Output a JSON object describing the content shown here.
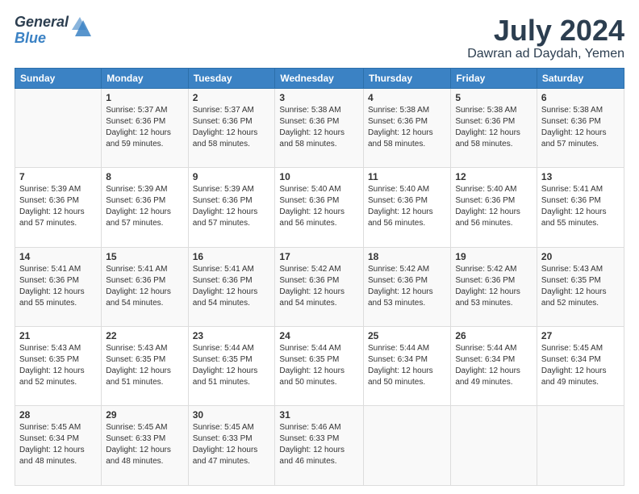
{
  "header": {
    "logo_general": "General",
    "logo_blue": "Blue",
    "month_title": "July 2024",
    "location": "Dawran ad Daydah, Yemen"
  },
  "days_of_week": [
    "Sunday",
    "Monday",
    "Tuesday",
    "Wednesday",
    "Thursday",
    "Friday",
    "Saturday"
  ],
  "weeks": [
    [
      {
        "day": "",
        "sunrise": "",
        "sunset": "",
        "daylight": ""
      },
      {
        "day": "1",
        "sunrise": "Sunrise: 5:37 AM",
        "sunset": "Sunset: 6:36 PM",
        "daylight": "Daylight: 12 hours and 59 minutes."
      },
      {
        "day": "2",
        "sunrise": "Sunrise: 5:37 AM",
        "sunset": "Sunset: 6:36 PM",
        "daylight": "Daylight: 12 hours and 58 minutes."
      },
      {
        "day": "3",
        "sunrise": "Sunrise: 5:38 AM",
        "sunset": "Sunset: 6:36 PM",
        "daylight": "Daylight: 12 hours and 58 minutes."
      },
      {
        "day": "4",
        "sunrise": "Sunrise: 5:38 AM",
        "sunset": "Sunset: 6:36 PM",
        "daylight": "Daylight: 12 hours and 58 minutes."
      },
      {
        "day": "5",
        "sunrise": "Sunrise: 5:38 AM",
        "sunset": "Sunset: 6:36 PM",
        "daylight": "Daylight: 12 hours and 58 minutes."
      },
      {
        "day": "6",
        "sunrise": "Sunrise: 5:38 AM",
        "sunset": "Sunset: 6:36 PM",
        "daylight": "Daylight: 12 hours and 57 minutes."
      }
    ],
    [
      {
        "day": "7",
        "sunrise": "Sunrise: 5:39 AM",
        "sunset": "Sunset: 6:36 PM",
        "daylight": "Daylight: 12 hours and 57 minutes."
      },
      {
        "day": "8",
        "sunrise": "Sunrise: 5:39 AM",
        "sunset": "Sunset: 6:36 PM",
        "daylight": "Daylight: 12 hours and 57 minutes."
      },
      {
        "day": "9",
        "sunrise": "Sunrise: 5:39 AM",
        "sunset": "Sunset: 6:36 PM",
        "daylight": "Daylight: 12 hours and 57 minutes."
      },
      {
        "day": "10",
        "sunrise": "Sunrise: 5:40 AM",
        "sunset": "Sunset: 6:36 PM",
        "daylight": "Daylight: 12 hours and 56 minutes."
      },
      {
        "day": "11",
        "sunrise": "Sunrise: 5:40 AM",
        "sunset": "Sunset: 6:36 PM",
        "daylight": "Daylight: 12 hours and 56 minutes."
      },
      {
        "day": "12",
        "sunrise": "Sunrise: 5:40 AM",
        "sunset": "Sunset: 6:36 PM",
        "daylight": "Daylight: 12 hours and 56 minutes."
      },
      {
        "day": "13",
        "sunrise": "Sunrise: 5:41 AM",
        "sunset": "Sunset: 6:36 PM",
        "daylight": "Daylight: 12 hours and 55 minutes."
      }
    ],
    [
      {
        "day": "14",
        "sunrise": "Sunrise: 5:41 AM",
        "sunset": "Sunset: 6:36 PM",
        "daylight": "Daylight: 12 hours and 55 minutes."
      },
      {
        "day": "15",
        "sunrise": "Sunrise: 5:41 AM",
        "sunset": "Sunset: 6:36 PM",
        "daylight": "Daylight: 12 hours and 54 minutes."
      },
      {
        "day": "16",
        "sunrise": "Sunrise: 5:41 AM",
        "sunset": "Sunset: 6:36 PM",
        "daylight": "Daylight: 12 hours and 54 minutes."
      },
      {
        "day": "17",
        "sunrise": "Sunrise: 5:42 AM",
        "sunset": "Sunset: 6:36 PM",
        "daylight": "Daylight: 12 hours and 54 minutes."
      },
      {
        "day": "18",
        "sunrise": "Sunrise: 5:42 AM",
        "sunset": "Sunset: 6:36 PM",
        "daylight": "Daylight: 12 hours and 53 minutes."
      },
      {
        "day": "19",
        "sunrise": "Sunrise: 5:42 AM",
        "sunset": "Sunset: 6:36 PM",
        "daylight": "Daylight: 12 hours and 53 minutes."
      },
      {
        "day": "20",
        "sunrise": "Sunrise: 5:43 AM",
        "sunset": "Sunset: 6:35 PM",
        "daylight": "Daylight: 12 hours and 52 minutes."
      }
    ],
    [
      {
        "day": "21",
        "sunrise": "Sunrise: 5:43 AM",
        "sunset": "Sunset: 6:35 PM",
        "daylight": "Daylight: 12 hours and 52 minutes."
      },
      {
        "day": "22",
        "sunrise": "Sunrise: 5:43 AM",
        "sunset": "Sunset: 6:35 PM",
        "daylight": "Daylight: 12 hours and 51 minutes."
      },
      {
        "day": "23",
        "sunrise": "Sunrise: 5:44 AM",
        "sunset": "Sunset: 6:35 PM",
        "daylight": "Daylight: 12 hours and 51 minutes."
      },
      {
        "day": "24",
        "sunrise": "Sunrise: 5:44 AM",
        "sunset": "Sunset: 6:35 PM",
        "daylight": "Daylight: 12 hours and 50 minutes."
      },
      {
        "day": "25",
        "sunrise": "Sunrise: 5:44 AM",
        "sunset": "Sunset: 6:34 PM",
        "daylight": "Daylight: 12 hours and 50 minutes."
      },
      {
        "day": "26",
        "sunrise": "Sunrise: 5:44 AM",
        "sunset": "Sunset: 6:34 PM",
        "daylight": "Daylight: 12 hours and 49 minutes."
      },
      {
        "day": "27",
        "sunrise": "Sunrise: 5:45 AM",
        "sunset": "Sunset: 6:34 PM",
        "daylight": "Daylight: 12 hours and 49 minutes."
      }
    ],
    [
      {
        "day": "28",
        "sunrise": "Sunrise: 5:45 AM",
        "sunset": "Sunset: 6:34 PM",
        "daylight": "Daylight: 12 hours and 48 minutes."
      },
      {
        "day": "29",
        "sunrise": "Sunrise: 5:45 AM",
        "sunset": "Sunset: 6:33 PM",
        "daylight": "Daylight: 12 hours and 48 minutes."
      },
      {
        "day": "30",
        "sunrise": "Sunrise: 5:45 AM",
        "sunset": "Sunset: 6:33 PM",
        "daylight": "Daylight: 12 hours and 47 minutes."
      },
      {
        "day": "31",
        "sunrise": "Sunrise: 5:46 AM",
        "sunset": "Sunset: 6:33 PM",
        "daylight": "Daylight: 12 hours and 46 minutes."
      },
      {
        "day": "",
        "sunrise": "",
        "sunset": "",
        "daylight": ""
      },
      {
        "day": "",
        "sunrise": "",
        "sunset": "",
        "daylight": ""
      },
      {
        "day": "",
        "sunrise": "",
        "sunset": "",
        "daylight": ""
      }
    ]
  ]
}
